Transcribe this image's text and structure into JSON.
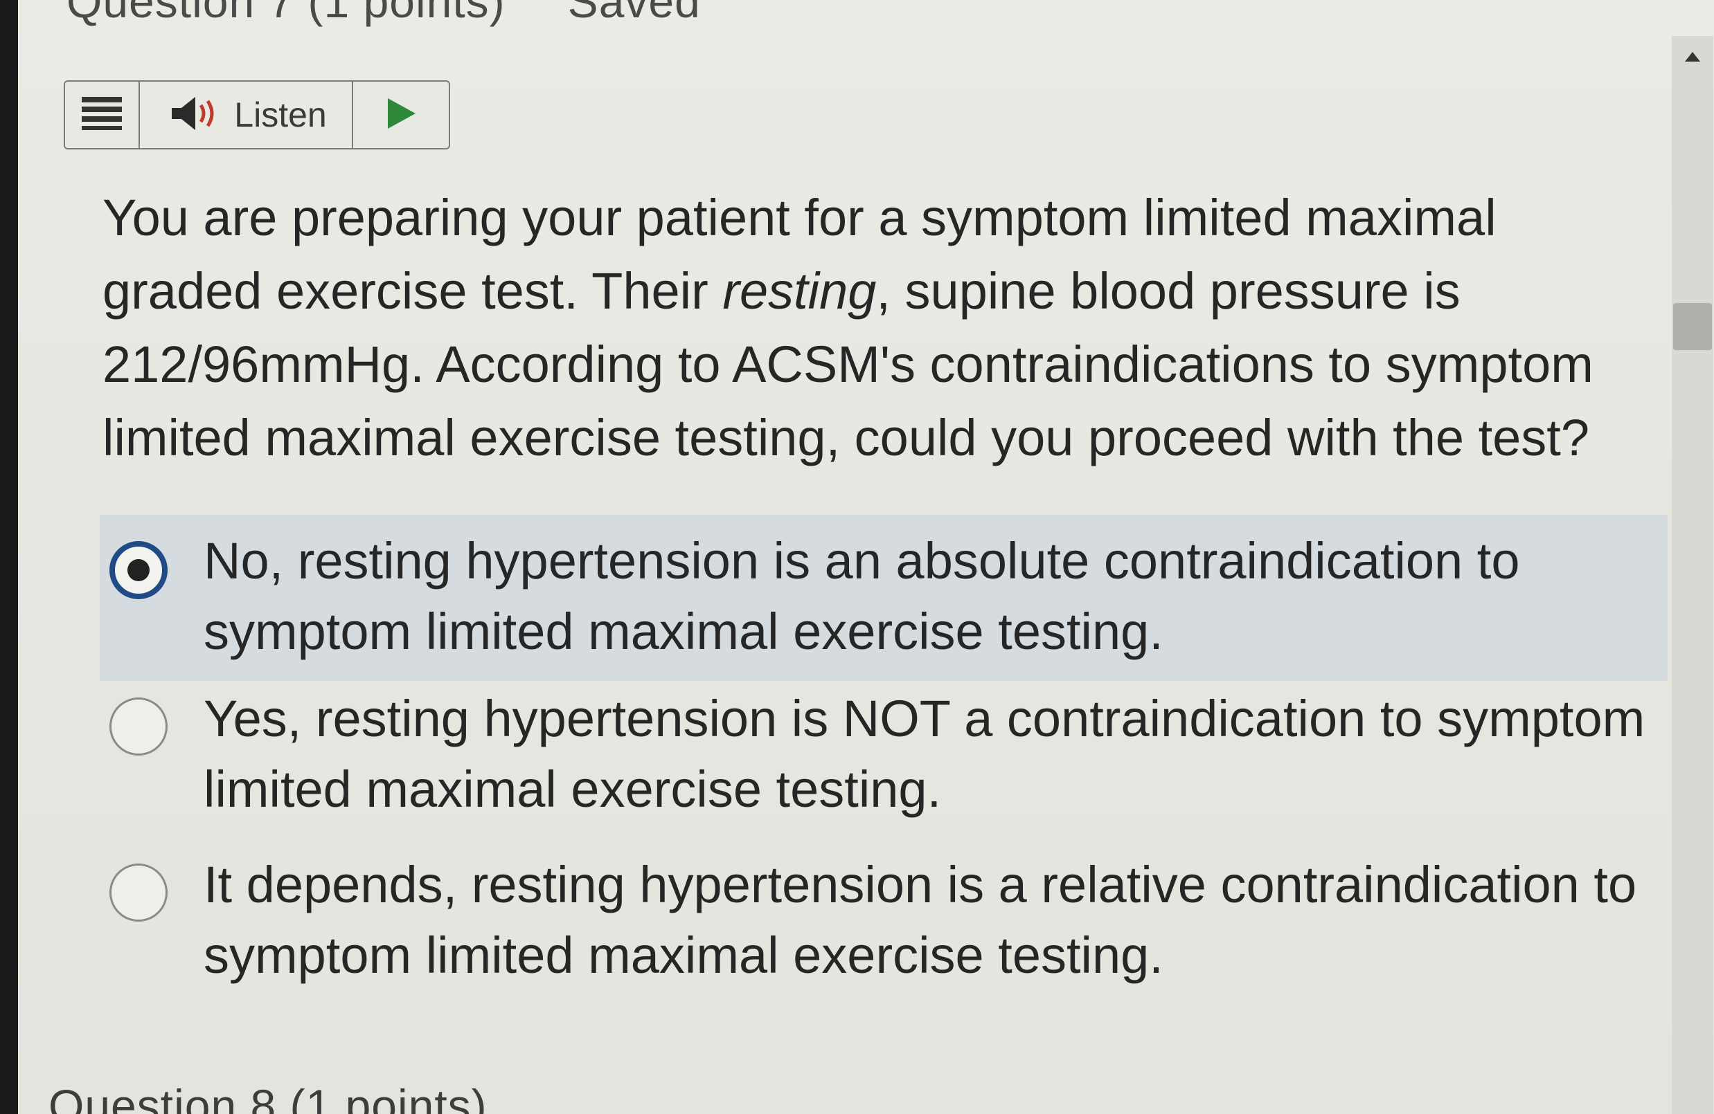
{
  "page": {
    "prev_heading": "Question 7 (1 points)",
    "prev_status": "Saved",
    "next_heading": "Question 8 (1 points)"
  },
  "toolbar": {
    "menu_icon": "hamburger-icon",
    "speaker_icon": "speaker-icon",
    "listen_label": "Listen",
    "play_icon": "play-icon",
    "accent_color": "#2e8a3a"
  },
  "question": {
    "part1": "You are preparing your patient for a symptom limited maximal graded exercise test. Their ",
    "emphasis": "resting",
    "part2": ", supine blood pressure is 212/96mmHg. According to ACSM's contraindications to symptom limited maximal exercise testing, could you proceed with the test?"
  },
  "options": [
    {
      "label": "No, resting hypertension is an absolute contraindication to symptom limited maximal exercise testing.",
      "selected": true
    },
    {
      "label": "Yes, resting hypertension is NOT a contraindication to symptom limited maximal exercise testing.",
      "selected": false
    },
    {
      "label": "It depends, resting hypertension is a relative contraindication to symptom limited maximal exercise testing.",
      "selected": false
    }
  ],
  "colors": {
    "selected_row": "#d5dbdf",
    "radio_ring": "#1f4a85"
  }
}
